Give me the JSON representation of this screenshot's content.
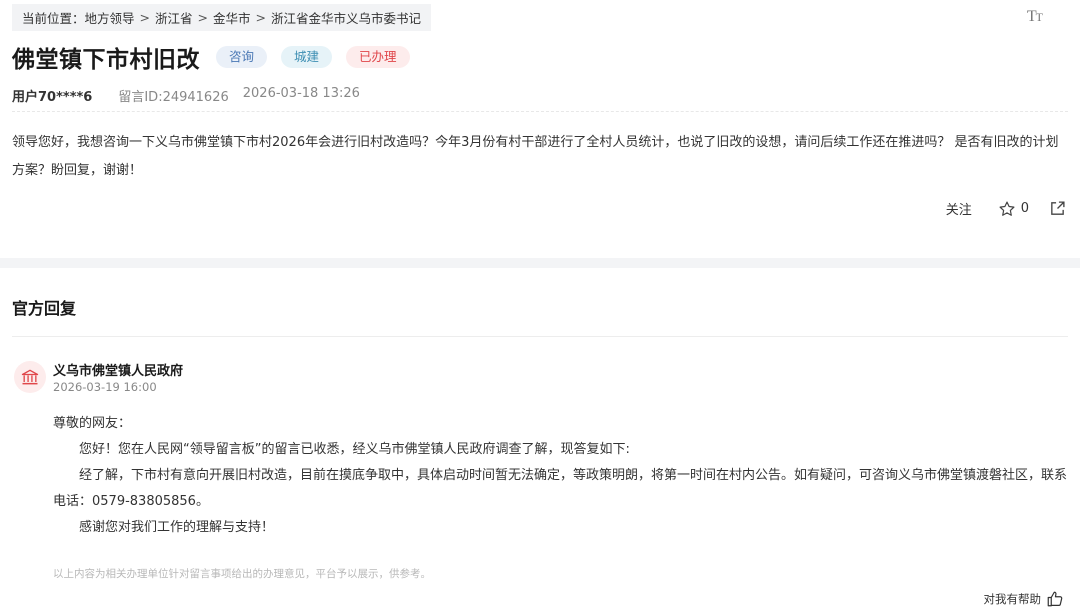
{
  "breadcrumb": {
    "prefix": "当前位置：",
    "items": [
      "地方领导",
      "浙江省",
      "金华市",
      "浙江省金华市义乌市委书记"
    ],
    "separator": ">"
  },
  "font_toggle": "Tт",
  "title": "佛堂镇下市村旧改",
  "tags": {
    "type": "咨询",
    "category": "城建",
    "status": "已办理"
  },
  "meta": {
    "user": "用户70****6",
    "message_id": "留言ID:24941626",
    "datetime": "2026-03-18 13:26"
  },
  "question": "领导您好，我想咨询一下义乌市佛堂镇下市村2026年会进行旧村改造吗？今年3月份有村干部进行了全村人员统计，也说了旧改的设想，请问后续工作还在推进吗？ 是否有旧改的计划方案？盼回复，谢谢！",
  "actions": {
    "follow": "关注",
    "star_count": "0"
  },
  "reply": {
    "heading": "官方回复",
    "org_name": "义乌市佛堂镇人民政府",
    "date": "2026-03-19 16:00",
    "greeting": "尊敬的网友：",
    "paragraph1": "您好！您在人民网“领导留言板”的留言已收悉，经义乌市佛堂镇人民政府调查了解，现答复如下:",
    "paragraph2": "经了解，下市村有意向开展旧村改造，目前在摸底争取中，具体启动时间暂无法确定，等政策明朗，将第一时间在村内公告。如有疑问，可咨询义乌市佛堂镇渡磐社区，联系电话：0579-83805856。",
    "paragraph3": "感谢您对我们工作的理解与支持！",
    "disclaimer": "以上内容为相关办理单位针对留言事项给出的办理意见，平台予以展示，供参考。",
    "helpful": "对我有帮助"
  },
  "colors": {
    "status_red": "#e0464a",
    "tag_blue": "#4a78b5",
    "org_icon_red": "#e0464a"
  }
}
